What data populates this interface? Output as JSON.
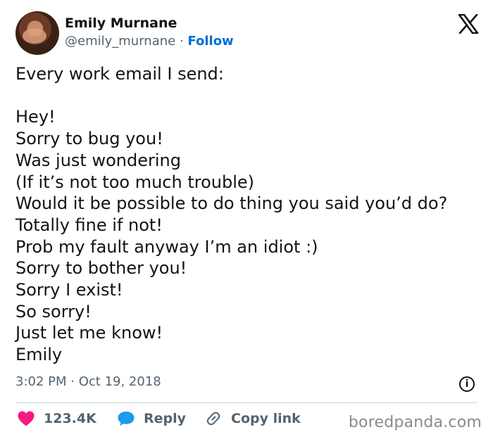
{
  "author": {
    "name": "Emily Murnane",
    "handle": "@emily_murnane",
    "separator": "·",
    "follow_label": "Follow"
  },
  "tweet": {
    "intro": "Every work email I send:",
    "lines": [
      "Hey!",
      "Sorry to bug you!",
      "Was just wondering",
      "(If it’s not too much trouble)",
      "Would it be possible to do thing you said you’d do?",
      "Totally fine if not!",
      "Prob my fault anyway I’m an idiot :)",
      "Sorry to bother you!",
      "Sorry I exist!",
      "So sorry!",
      "Just let me know!",
      "Emily"
    ]
  },
  "meta": {
    "time": "3:02 PM",
    "separator": "·",
    "date": "Oct 19, 2018"
  },
  "actions": {
    "likes": "123.4K",
    "reply": "Reply",
    "copy_link": "Copy link"
  },
  "watermark": "boredpanda.com",
  "colors": {
    "follow": "#006fd6",
    "like": "#f91880",
    "reply": "#1d9bf0",
    "muted": "#536471"
  },
  "icons": {
    "logo": "x-logo-icon",
    "info": "info-icon",
    "like": "heart-icon",
    "reply": "speech-bubble-icon",
    "copy": "link-icon"
  }
}
